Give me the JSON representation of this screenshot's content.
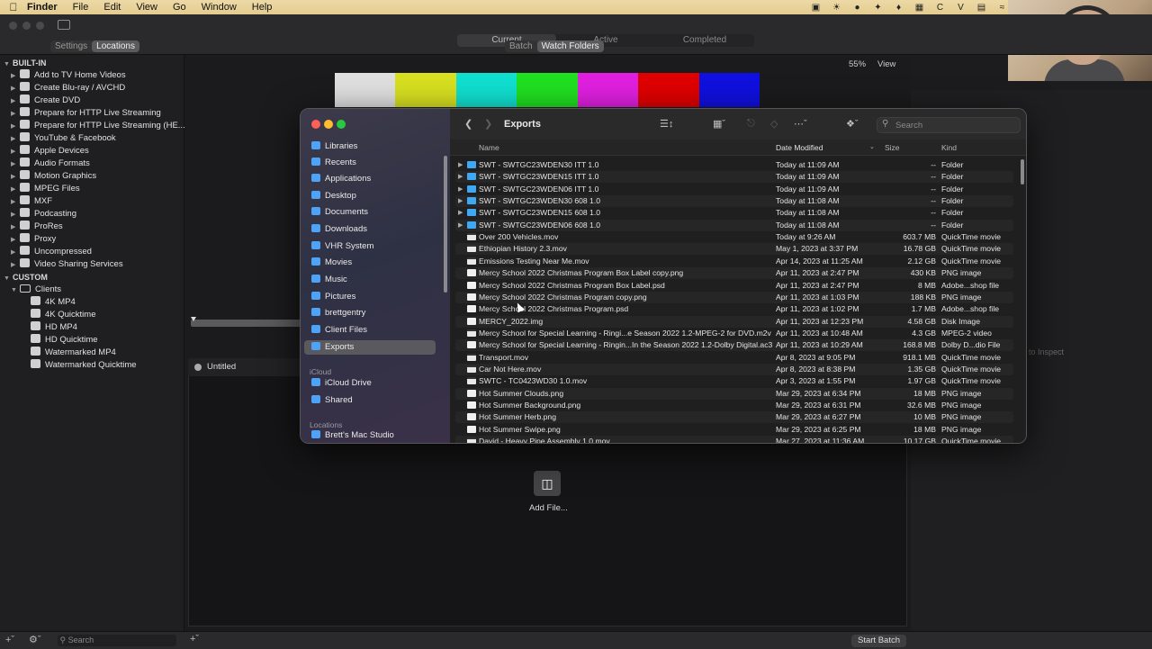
{
  "menubar": {
    "app": "Finder",
    "items": [
      "File",
      "Edit",
      "View",
      "Go",
      "Window",
      "Help"
    ]
  },
  "compressor": {
    "top_tabs": [
      "Current",
      "Active",
      "Completed"
    ],
    "left_tabs": [
      "Settings",
      "Locations"
    ],
    "center_tabs": [
      "Batch",
      "Watch Folders"
    ],
    "zoom": "55%",
    "view_menu": "View",
    "color_bars": [
      "#e0e0e0",
      "#d8e020",
      "#10e0d0",
      "#20e020",
      "#e020e0",
      "#e00000",
      "#1010e0"
    ],
    "tree": [
      {
        "label": "BUILT-IN",
        "type": "section"
      },
      {
        "label": "Add to TV Home Videos",
        "type": "group"
      },
      {
        "label": "Create Blu-ray / AVCHD",
        "type": "group"
      },
      {
        "label": "Create DVD",
        "type": "group"
      },
      {
        "label": "Prepare for HTTP Live Streaming",
        "type": "group"
      },
      {
        "label": "Prepare for HTTP Live Streaming (HE...",
        "type": "group"
      },
      {
        "label": "YouTube & Facebook",
        "type": "group"
      },
      {
        "label": "Apple Devices",
        "type": "group"
      },
      {
        "label": "Audio Formats",
        "type": "group"
      },
      {
        "label": "Motion Graphics",
        "type": "group"
      },
      {
        "label": "MPEG Files",
        "type": "group"
      },
      {
        "label": "MXF",
        "type": "group"
      },
      {
        "label": "Podcasting",
        "type": "group"
      },
      {
        "label": "ProRes",
        "type": "group"
      },
      {
        "label": "Proxy",
        "type": "group"
      },
      {
        "label": "Uncompressed",
        "type": "group"
      },
      {
        "label": "Video Sharing Services",
        "type": "group"
      },
      {
        "label": "CUSTOM",
        "type": "section"
      },
      {
        "label": "Clients",
        "type": "folder"
      },
      {
        "label": "4K MP4",
        "type": "preset"
      },
      {
        "label": "4K Quicktime",
        "type": "preset"
      },
      {
        "label": "HD MP4",
        "type": "preset"
      },
      {
        "label": "HD Quicktime",
        "type": "preset"
      },
      {
        "label": "Watermarked MP4",
        "type": "preset"
      },
      {
        "label": "Watermarked Quicktime",
        "type": "preset"
      }
    ],
    "batch_name": "Untitled",
    "add_file": "Add File...",
    "inspect_hint": "to Inspect",
    "search_placeholder": "Search",
    "start_batch": "Start Batch"
  },
  "finder": {
    "title": "Exports",
    "search_placeholder": "Search",
    "sidebar": [
      {
        "label": "Libraries",
        "type": "item"
      },
      {
        "label": "Recents",
        "type": "item"
      },
      {
        "label": "Applications",
        "type": "item"
      },
      {
        "label": "Desktop",
        "type": "item"
      },
      {
        "label": "Documents",
        "type": "item"
      },
      {
        "label": "Downloads",
        "type": "item"
      },
      {
        "label": "VHR System",
        "type": "item"
      },
      {
        "label": "Movies",
        "type": "item"
      },
      {
        "label": "Music",
        "type": "item"
      },
      {
        "label": "Pictures",
        "type": "item"
      },
      {
        "label": "brettgentry",
        "type": "item"
      },
      {
        "label": "Client Files",
        "type": "item"
      },
      {
        "label": "Exports",
        "type": "selected"
      },
      {
        "label": "iCloud",
        "type": "heading"
      },
      {
        "label": "iCloud Drive",
        "type": "item"
      },
      {
        "label": "Shared",
        "type": "item"
      },
      {
        "label": "Locations",
        "type": "heading"
      },
      {
        "label": "Brett's Mac Studio",
        "type": "item"
      }
    ],
    "columns": {
      "name": "Name",
      "date": "Date Modified",
      "size": "Size",
      "kind": "Kind"
    },
    "files": [
      {
        "name": "SWT - SWTGC23WDEN30 ITT 1.0",
        "date": "Today at 11:09 AM",
        "size": "--",
        "kind": "Folder",
        "icon": "folder"
      },
      {
        "name": "SWT - SWTGC23WDEN15 ITT 1.0",
        "date": "Today at 11:09 AM",
        "size": "--",
        "kind": "Folder",
        "icon": "folder"
      },
      {
        "name": "SWT - SWTGC23WDEN06 ITT 1.0",
        "date": "Today at 11:09 AM",
        "size": "--",
        "kind": "Folder",
        "icon": "folder"
      },
      {
        "name": "SWT - SWTGC23WDEN30 608 1.0",
        "date": "Today at 11:08 AM",
        "size": "--",
        "kind": "Folder",
        "icon": "folder"
      },
      {
        "name": "SWT - SWTGC23WDEN15 608 1.0",
        "date": "Today at 11:08 AM",
        "size": "--",
        "kind": "Folder",
        "icon": "folder"
      },
      {
        "name": "SWT - SWTGC23WDEN06 608 1.0",
        "date": "Today at 11:08 AM",
        "size": "--",
        "kind": "Folder",
        "icon": "folder"
      },
      {
        "name": "Over 200 Vehicles.mov",
        "date": "Today at 9:26 AM",
        "size": "603.7 MB",
        "kind": "QuickTime movie",
        "icon": "movie"
      },
      {
        "name": "Ethiopian History 2.3.mov",
        "date": "May 1, 2023 at 3:37 PM",
        "size": "16.78 GB",
        "kind": "QuickTime movie",
        "icon": "movie"
      },
      {
        "name": "Emissions Testing Near Me.mov",
        "date": "Apr 14, 2023 at 11:25 AM",
        "size": "2.12 GB",
        "kind": "QuickTime movie",
        "icon": "movie"
      },
      {
        "name": "Mercy School 2022 Christmas Program Box Label copy.png",
        "date": "Apr 11, 2023 at 2:47 PM",
        "size": "430 KB",
        "kind": "PNG image",
        "icon": "file"
      },
      {
        "name": "Mercy School 2022 Christmas Program Box Label.psd",
        "date": "Apr 11, 2023 at 2:47 PM",
        "size": "8 MB",
        "kind": "Adobe...shop file",
        "icon": "file"
      },
      {
        "name": "Mercy School 2022 Christmas Program copy.png",
        "date": "Apr 11, 2023 at 1:03 PM",
        "size": "188 KB",
        "kind": "PNG image",
        "icon": "file"
      },
      {
        "name": "Mercy School 2022 Christmas Program.psd",
        "date": "Apr 11, 2023 at 1:02 PM",
        "size": "1.7 MB",
        "kind": "Adobe...shop file",
        "icon": "file"
      },
      {
        "name": "MERCY_2022.img",
        "date": "Apr 11, 2023 at 12:23 PM",
        "size": "4.58 GB",
        "kind": "Disk Image",
        "icon": "file"
      },
      {
        "name": "Mercy School for Special Learning - Ringi...e Season 2022 1.2-MPEG-2 for DVD.m2v",
        "date": "Apr 11, 2023 at 10:48 AM",
        "size": "4.3 GB",
        "kind": "MPEG-2 video",
        "icon": "movie"
      },
      {
        "name": "Mercy School for Special Learning - Ringin...In the Season 2022 1.2-Dolby Digital.ac3",
        "date": "Apr 11, 2023 at 10:29 AM",
        "size": "168.8 MB",
        "kind": "Dolby D...dio File",
        "icon": "file"
      },
      {
        "name": "Transport.mov",
        "date": "Apr 8, 2023 at 9:05 PM",
        "size": "918.1 MB",
        "kind": "QuickTime movie",
        "icon": "movie"
      },
      {
        "name": "Car Not Here.mov",
        "date": "Apr 8, 2023 at 8:38 PM",
        "size": "1.35 GB",
        "kind": "QuickTime movie",
        "icon": "movie"
      },
      {
        "name": "SWTC - TC0423WD30 1.0.mov",
        "date": "Apr 3, 2023 at 1:55 PM",
        "size": "1.97 GB",
        "kind": "QuickTime movie",
        "icon": "movie"
      },
      {
        "name": "Hot Summer Clouds.png",
        "date": "Mar 29, 2023 at 6:34 PM",
        "size": "18 MB",
        "kind": "PNG image",
        "icon": "file"
      },
      {
        "name": "Hot Summer Background.png",
        "date": "Mar 29, 2023 at 6:31 PM",
        "size": "32.6 MB",
        "kind": "PNG image",
        "icon": "file"
      },
      {
        "name": "Hot Summer Herb.png",
        "date": "Mar 29, 2023 at 6:27 PM",
        "size": "10 MB",
        "kind": "PNG image",
        "icon": "file"
      },
      {
        "name": "Hot Summer Swipe.png",
        "date": "Mar 29, 2023 at 6:25 PM",
        "size": "18 MB",
        "kind": "PNG image",
        "icon": "file"
      },
      {
        "name": "David - Heavy Pipe Assembly 1.0.mov",
        "date": "Mar 27, 2023 at 11:36 AM",
        "size": "10.17 GB",
        "kind": "QuickTime movie",
        "icon": "movie"
      }
    ]
  }
}
